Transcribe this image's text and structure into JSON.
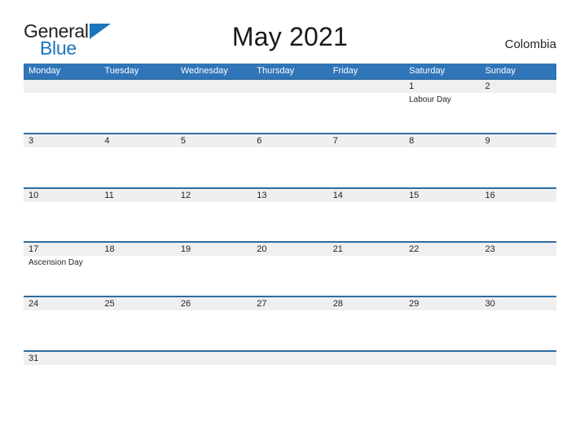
{
  "header": {
    "logo": {
      "primary_text": "General",
      "secondary_text": "Blue",
      "primary_color": "#231f20",
      "secondary_color": "#1b75bb",
      "mark": "triangle-mark"
    },
    "month_title": "May 2021",
    "country": "Colombia"
  },
  "theme": {
    "header_blue": "#3075b8",
    "rule_blue": "#2e6da4",
    "band_gray": "#efefef",
    "text_color": "#231f20"
  },
  "calendar": {
    "weekdays": [
      "Monday",
      "Tuesday",
      "Wednesday",
      "Thursday",
      "Friday",
      "Saturday",
      "Sunday"
    ],
    "weeks": [
      [
        {
          "day": "",
          "event": ""
        },
        {
          "day": "",
          "event": ""
        },
        {
          "day": "",
          "event": ""
        },
        {
          "day": "",
          "event": ""
        },
        {
          "day": "",
          "event": ""
        },
        {
          "day": "1",
          "event": "Labour Day"
        },
        {
          "day": "2",
          "event": ""
        }
      ],
      [
        {
          "day": "3",
          "event": ""
        },
        {
          "day": "4",
          "event": ""
        },
        {
          "day": "5",
          "event": ""
        },
        {
          "day": "6",
          "event": ""
        },
        {
          "day": "7",
          "event": ""
        },
        {
          "day": "8",
          "event": ""
        },
        {
          "day": "9",
          "event": ""
        }
      ],
      [
        {
          "day": "10",
          "event": ""
        },
        {
          "day": "11",
          "event": ""
        },
        {
          "day": "12",
          "event": ""
        },
        {
          "day": "13",
          "event": ""
        },
        {
          "day": "14",
          "event": ""
        },
        {
          "day": "15",
          "event": ""
        },
        {
          "day": "16",
          "event": ""
        }
      ],
      [
        {
          "day": "17",
          "event": "Ascension Day"
        },
        {
          "day": "18",
          "event": ""
        },
        {
          "day": "19",
          "event": ""
        },
        {
          "day": "20",
          "event": ""
        },
        {
          "day": "21",
          "event": ""
        },
        {
          "day": "22",
          "event": ""
        },
        {
          "day": "23",
          "event": ""
        }
      ],
      [
        {
          "day": "24",
          "event": ""
        },
        {
          "day": "25",
          "event": ""
        },
        {
          "day": "26",
          "event": ""
        },
        {
          "day": "27",
          "event": ""
        },
        {
          "day": "28",
          "event": ""
        },
        {
          "day": "29",
          "event": ""
        },
        {
          "day": "30",
          "event": ""
        }
      ],
      [
        {
          "day": "31",
          "event": ""
        },
        {
          "day": "",
          "event": ""
        },
        {
          "day": "",
          "event": ""
        },
        {
          "day": "",
          "event": ""
        },
        {
          "day": "",
          "event": ""
        },
        {
          "day": "",
          "event": ""
        },
        {
          "day": "",
          "event": ""
        }
      ]
    ]
  }
}
